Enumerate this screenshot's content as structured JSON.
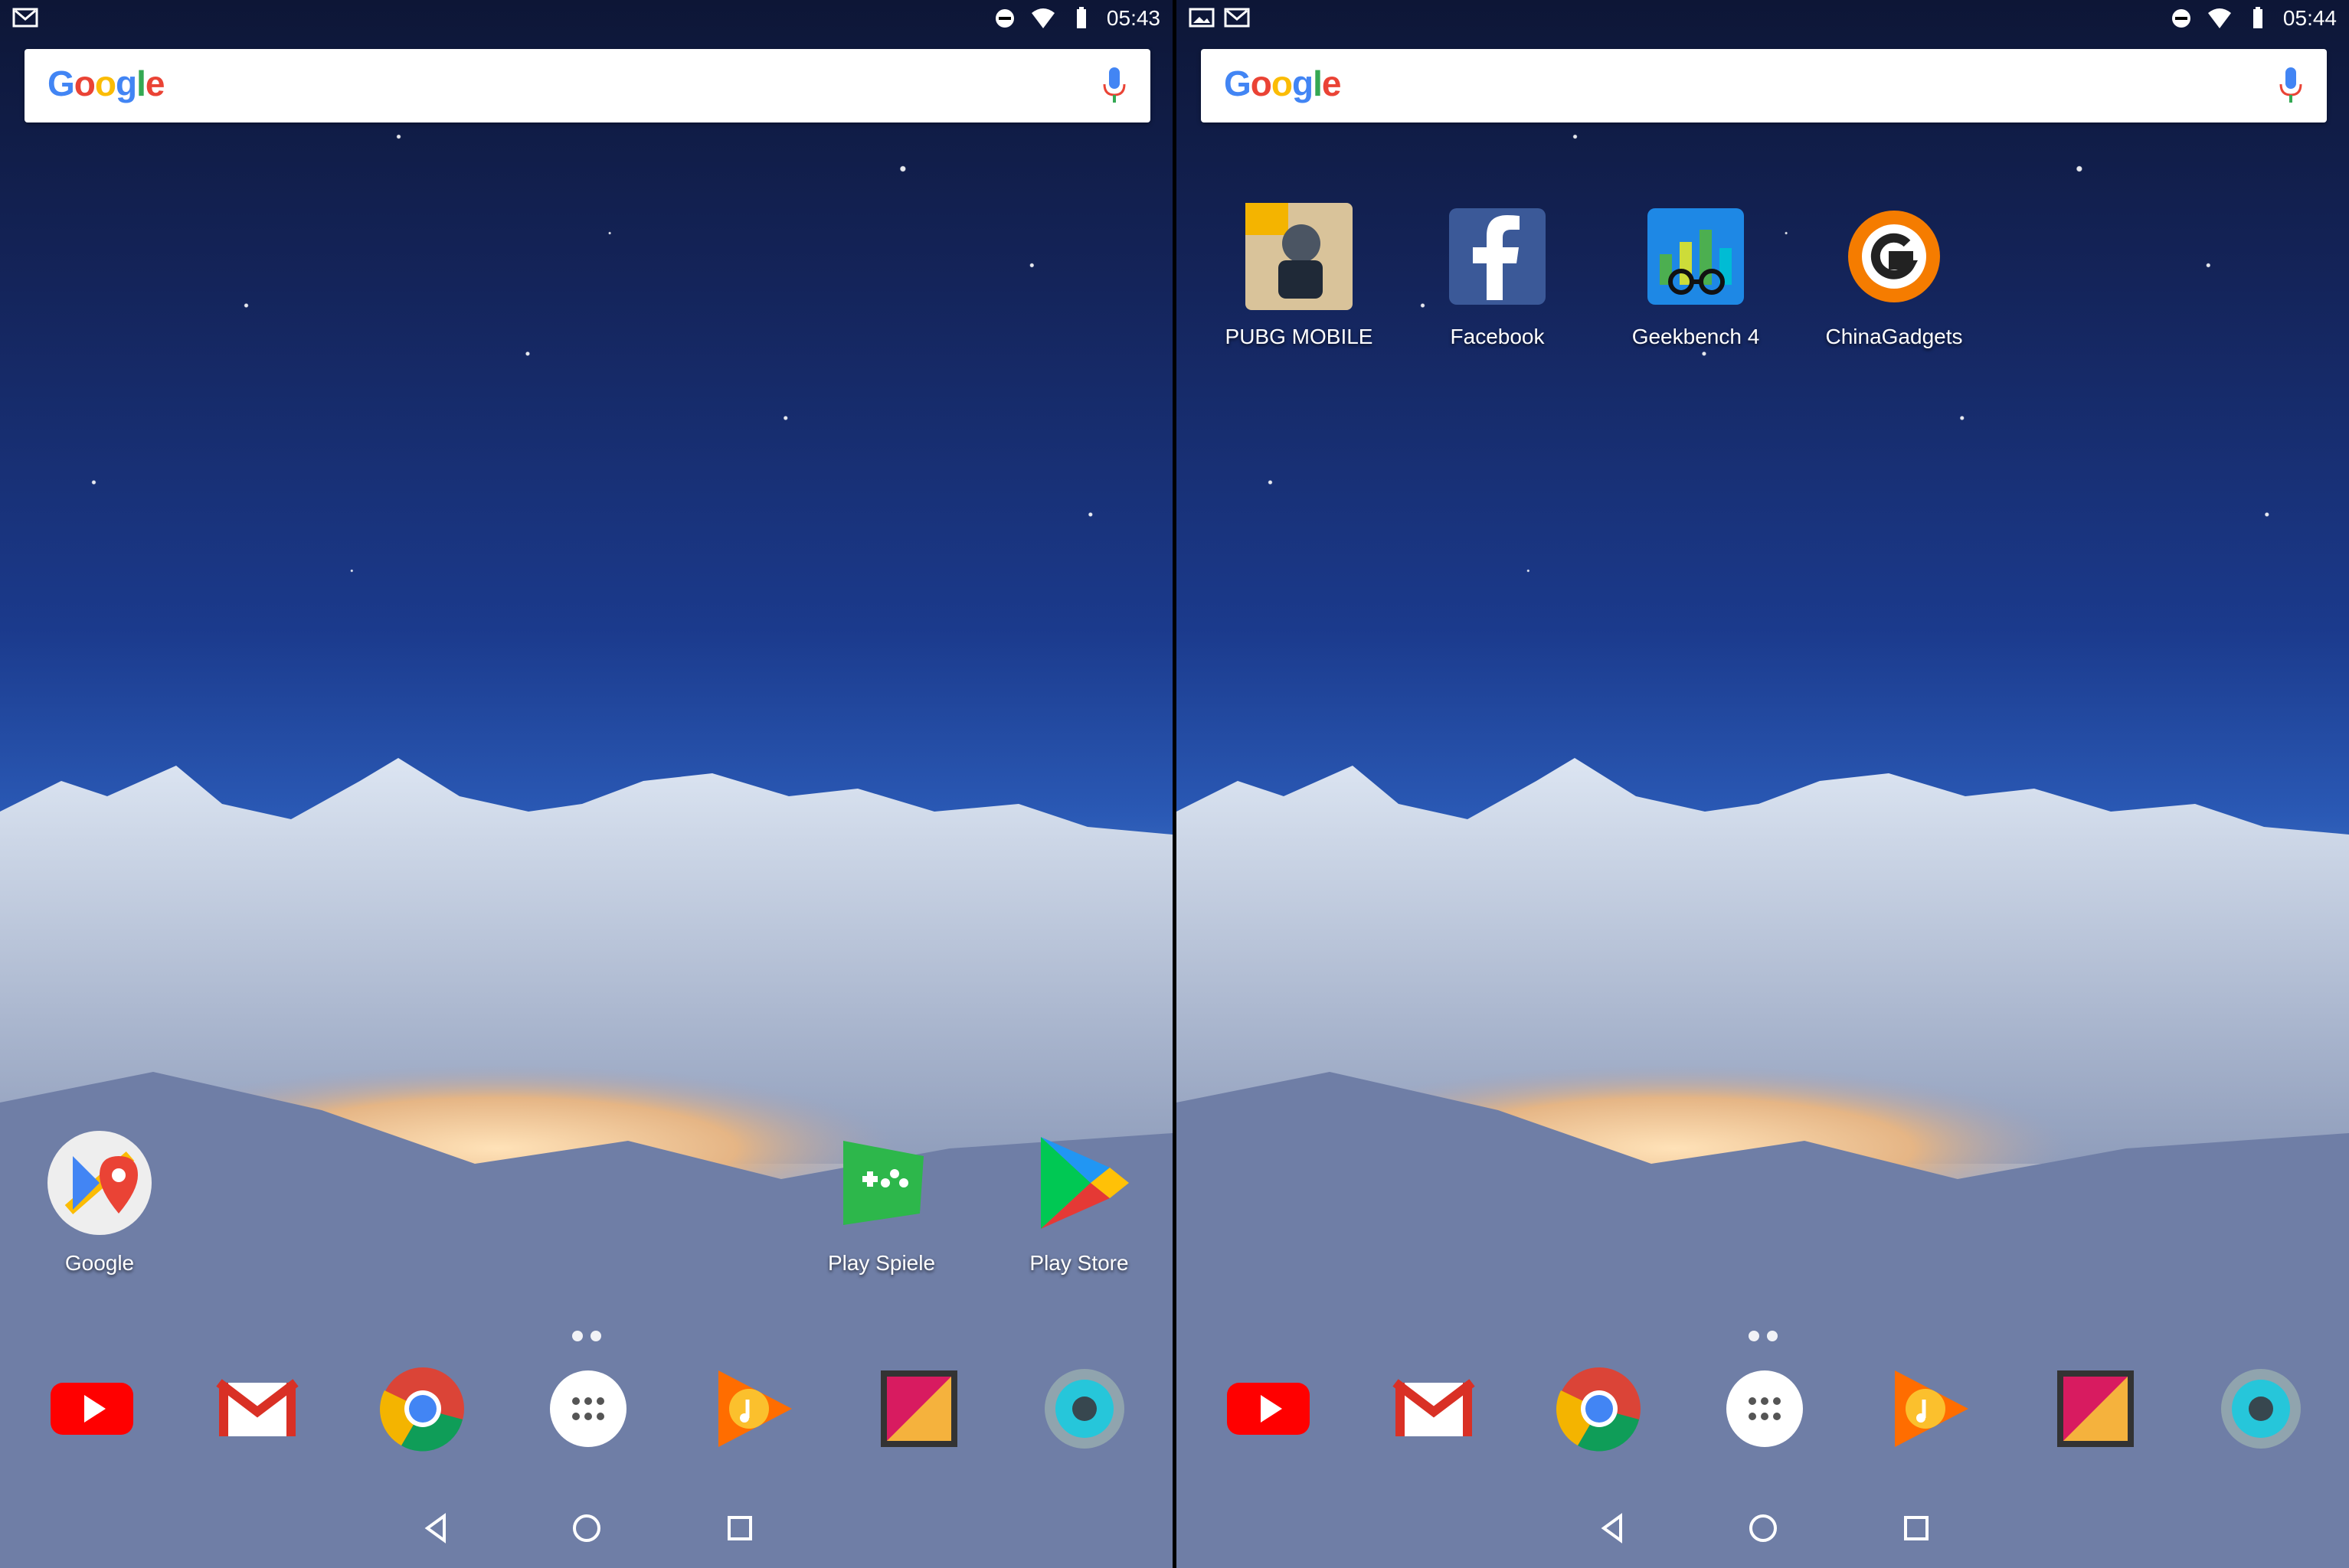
{
  "screens": [
    {
      "status": {
        "time": "05:43"
      },
      "search": {
        "logo_text": "Google"
      },
      "apps": [
        {
          "label": "Google",
          "icon": "google-maps-icon"
        },
        {
          "label": "Play Spiele",
          "icon": "play-games-icon"
        },
        {
          "label": "Play Store",
          "icon": "play-store-icon"
        }
      ],
      "dock": [
        {
          "icon": "youtube-icon"
        },
        {
          "icon": "gmail-icon"
        },
        {
          "icon": "chrome-icon"
        },
        {
          "icon": "app-drawer-icon"
        },
        {
          "icon": "play-music-icon"
        },
        {
          "icon": "gallery-icon"
        },
        {
          "icon": "camera-icon"
        }
      ]
    },
    {
      "status": {
        "time": "05:44"
      },
      "search": {
        "logo_text": "Google"
      },
      "apps": [
        {
          "label": "PUBG MOBILE",
          "icon": "pubg-icon"
        },
        {
          "label": "Facebook",
          "icon": "facebook-icon"
        },
        {
          "label": "Geekbench 4",
          "icon": "geekbench-icon"
        },
        {
          "label": "ChinaGadgets",
          "icon": "chinagadgets-icon"
        }
      ],
      "dock": [
        {
          "icon": "youtube-icon"
        },
        {
          "icon": "gmail-icon"
        },
        {
          "icon": "chrome-icon"
        },
        {
          "icon": "app-drawer-icon"
        },
        {
          "icon": "play-music-icon"
        },
        {
          "icon": "gallery-icon"
        },
        {
          "icon": "camera-icon"
        }
      ]
    }
  ]
}
